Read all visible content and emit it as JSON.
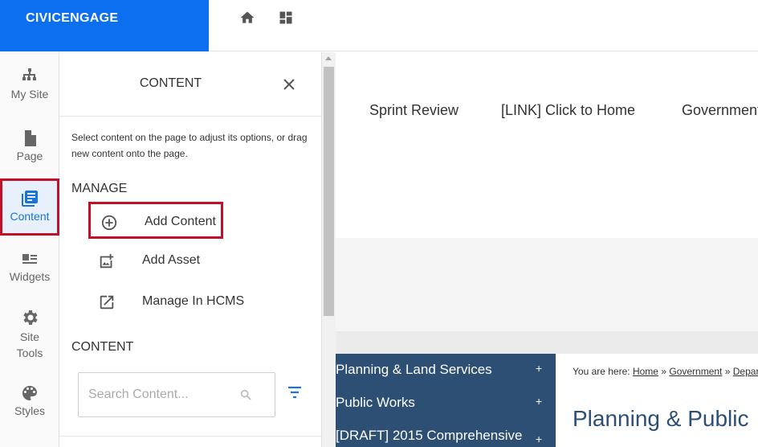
{
  "brand": {
    "name": "CIVICENGAGE",
    "color": "#0b6ff0"
  },
  "topbar": {
    "icons": [
      "home-icon",
      "dashboard-icon"
    ]
  },
  "rail": {
    "items": [
      {
        "label": "My Site",
        "icon": "sitemap-icon"
      },
      {
        "label": "Page",
        "icon": "page-icon"
      },
      {
        "label": "Content",
        "icon": "content-icon",
        "active": true
      },
      {
        "label": "Widgets",
        "icon": "widgets-icon"
      },
      {
        "label_line1": "Site",
        "label_line2": "Tools",
        "icon": "gear-icon"
      },
      {
        "label": "Styles",
        "icon": "palette-icon"
      }
    ]
  },
  "panel": {
    "title": "CONTENT",
    "intro": "Select content on the page to adjust its options, or drag new content onto the page.",
    "manage_label": "MANAGE",
    "actions": [
      {
        "label": "Add Content",
        "icon": "add-circle-icon"
      },
      {
        "label": "Add Asset",
        "icon": "add-image-icon"
      },
      {
        "label": "Manage In HCMS",
        "icon": "external-link-icon"
      }
    ],
    "content_label": "CONTENT",
    "search": {
      "placeholder": "Search Content...",
      "value": ""
    }
  },
  "preview": {
    "nav": [
      "Sprint Review",
      "[LINK] Click to Home",
      "Government"
    ],
    "side_nav": [
      {
        "label": "Planning & Land Services",
        "expand": "+"
      },
      {
        "label": "Public Works",
        "expand": "+"
      },
      {
        "label": "[DRAFT] 2015 Comprehensive",
        "expand": "+"
      }
    ],
    "breadcrumb": {
      "prefix": "You are here:",
      "links": [
        "Home",
        "Government",
        "Depart"
      ],
      "separator": "»"
    },
    "heading": "Planning & Public"
  },
  "colors": {
    "accent": "#1a73d8",
    "highlight_border": "#c0102a",
    "side_nav_bg": "#2c4f73"
  }
}
